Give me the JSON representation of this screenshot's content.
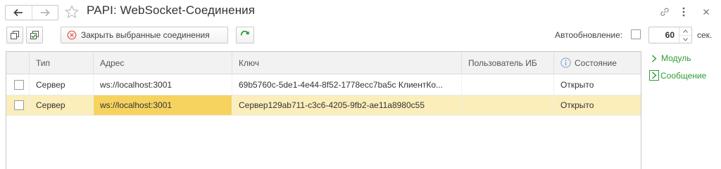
{
  "window": {
    "title": "РАPI: WebSocket-Соединения"
  },
  "toolbar": {
    "close_selected_label": "Закрыть выбранные соединения",
    "autorefresh_label": "Автообновление:",
    "autorefresh_checked": false,
    "interval_value": "60",
    "interval_unit": "сек."
  },
  "table": {
    "columns": [
      "Тип",
      "Адрес",
      "Ключ",
      "Пользователь ИБ",
      "Состояние"
    ],
    "rows": [
      {
        "type": "Сервер",
        "address": "ws://localhost:3001",
        "key": "69b5760c-5de1-4e44-8f52-1778ecc7ba5c КлиентКо...",
        "user": "",
        "state": "Открыто",
        "selected": false
      },
      {
        "type": "Сервер",
        "address": "ws://localhost:3001",
        "key": "Сервер129ab711-c3c6-4205-9fb2-ae11a8980c55",
        "user": "",
        "state": "Открыто",
        "selected": true
      }
    ]
  },
  "side_panel": {
    "module_label": "Модуль",
    "message_label": "Сообщение"
  },
  "colors": {
    "accent_green": "#2d9b34",
    "selected_row": "#fbeebb",
    "selected_cell": "#f6d35f",
    "close_icon_red": "#e05a4a"
  },
  "icons": {
    "back": "arrow-left-icon",
    "forward": "arrow-right-icon",
    "favorite": "star-icon",
    "link": "link-icon",
    "more": "more-vertical-icon",
    "close": "close-icon",
    "copy": "copy-icon",
    "check_all": "check-all-icon",
    "close_connection": "circle-x-icon",
    "refresh": "refresh-icon",
    "info": "info-icon"
  }
}
